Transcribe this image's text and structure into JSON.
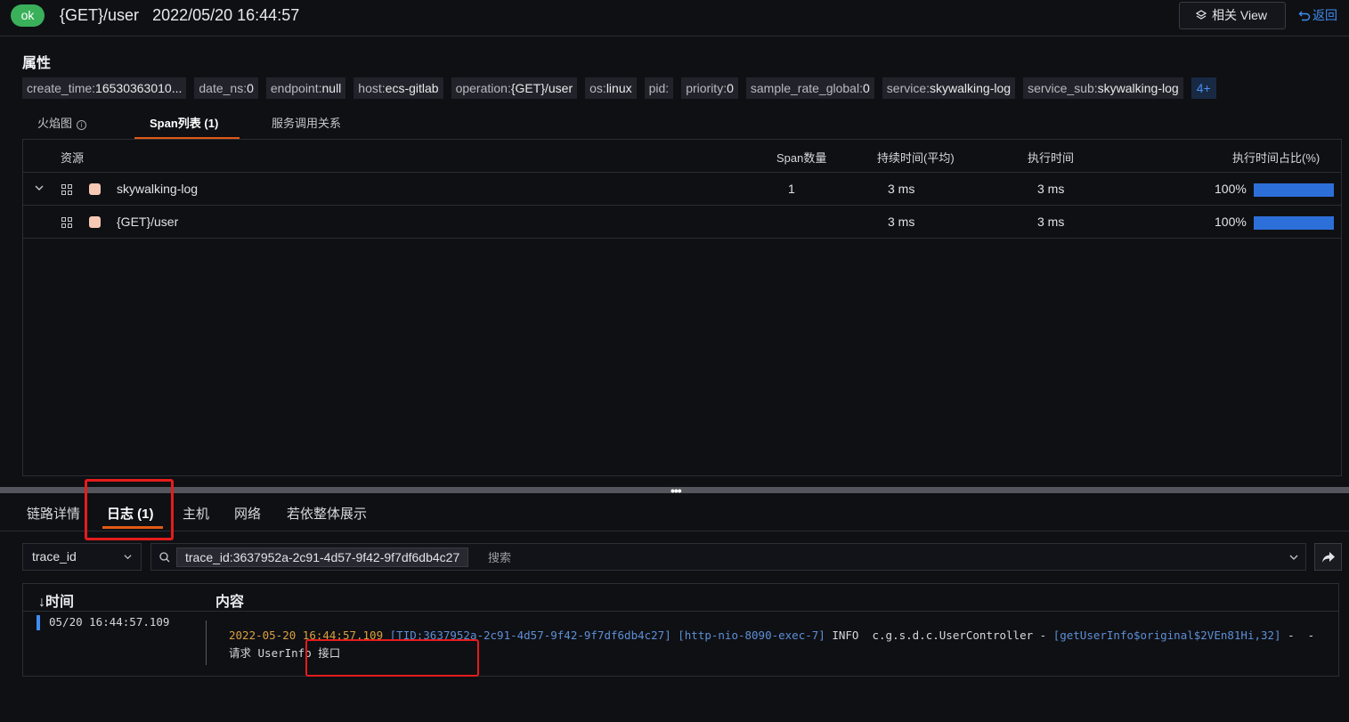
{
  "header": {
    "status": "ok",
    "title": "{GET}/user",
    "timestamp": "2022/05/20 16:44:57",
    "related_view": "相关 View",
    "back": "返回"
  },
  "attributes": {
    "title": "属性",
    "tags": [
      {
        "k": "create_time:",
        "v": "16530363010..."
      },
      {
        "k": "date_ns:",
        "v": "0"
      },
      {
        "k": "endpoint:",
        "v": "null"
      },
      {
        "k": "host:",
        "v": "ecs-gitlab"
      },
      {
        "k": "operation:",
        "v": "{GET}/user"
      },
      {
        "k": "os:",
        "v": "linux"
      },
      {
        "k": "pid:",
        "v": ""
      },
      {
        "k": "priority:",
        "v": "0"
      },
      {
        "k": "sample_rate_global:",
        "v": "0"
      },
      {
        "k": "service:",
        "v": "skywalking-log"
      },
      {
        "k": "service_sub:",
        "v": "skywalking-log"
      }
    ],
    "more": "4+"
  },
  "span_tabs": [
    "火焰图",
    "Span列表 (1)",
    "服务调用关系"
  ],
  "span_table": {
    "columns": [
      "资源",
      "Span数量",
      "持续时间(平均)",
      "执行时间",
      "执行时间占比(%)"
    ],
    "rows": [
      {
        "name": "skywalking-log",
        "count": "1",
        "duration": "3 ms",
        "exec": "3 ms",
        "pct": "100%",
        "pct_value": 1.0
      },
      {
        "name": "{GET}/user",
        "count": "",
        "duration": "3 ms",
        "exec": "3 ms",
        "pct": "100%",
        "pct_value": 1.0
      }
    ]
  },
  "bottom_tabs": [
    "链路详情",
    "日志 (1)",
    "主机",
    "网络",
    "若依整体展示"
  ],
  "search": {
    "field": "trace_id",
    "chip": "trace_id:3637952a-2c91-4d57-9f42-9f7df6db4c27",
    "placeholder": "搜索"
  },
  "log_table": {
    "col_time": "时间",
    "col_content": "内容",
    "row": {
      "time": "05/20 16:44:57.109",
      "date": "2022-05-20 ",
      "clock": "16:44:57.109",
      "tid": "[TID:3637952a-2c91-4d57-9f42-9f7df6db4c27]",
      "thread": "[http-nio-8090-exec-7]",
      "level_class": " INFO  c.g.s.d.c.UserController - ",
      "method": "[getUserInfo$original$2VEn81Hi,32]",
      "message": " -  - 请求 UserInfo 接口"
    }
  },
  "colors": {
    "accent": "#3f8df0",
    "tab_underline": "#e25a14",
    "ok": "#3ab05a",
    "highlight_box": "#e41c1c",
    "bar": "#2d6fd8"
  }
}
